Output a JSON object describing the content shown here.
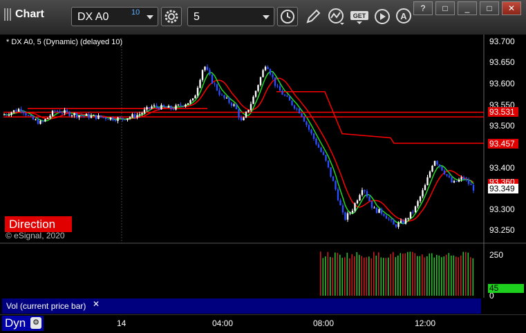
{
  "app": {
    "title": "Chart"
  },
  "toolbar": {
    "symbol": "DX A0",
    "delay": "10",
    "interval": "5",
    "icons": [
      "settings-gear-icon",
      "clock-icon",
      "pencil-icon",
      "indicator-icon",
      "get-icon",
      "play-icon",
      "alert-icon"
    ]
  },
  "window_buttons": {
    "help": "?",
    "restore_small": "□",
    "minimize": "_",
    "maximize": "□",
    "close": "✕"
  },
  "chart": {
    "label": "* DX A0, 5 (Dynamic) (delayed 10)",
    "direction": "Direction",
    "copyright": "© eSignal, 2020",
    "price_ticks": [
      "93.700",
      "93.650",
      "93.600",
      "93.550",
      "93.500",
      "93.400",
      "93.300",
      "93.250"
    ],
    "price_tags": [
      {
        "text": "93.531",
        "color": "#e00000",
        "fg": "#ffffff"
      },
      {
        "text": "93.457",
        "color": "#e00000",
        "fg": "#ffffff"
      },
      {
        "text": "93.360",
        "color": "#e00000",
        "fg": "#ffffff"
      },
      {
        "text": "93.349",
        "color": "#ffffff",
        "fg": "#000000"
      }
    ],
    "vol_ticks": [
      "250",
      "0"
    ],
    "vol_tag": "45",
    "vol_label": "Vol (current price bar)",
    "vol_close": "✕",
    "time_ticks": [
      "14",
      "04:00",
      "08:00",
      "12:00"
    ],
    "dyn": "Dyn",
    "colors": {
      "up": "#ffffff",
      "down": "#2a4dff",
      "ma_red": "#ff0000",
      "ma_green": "#22dd22",
      "vol_green": "#2bbf2b",
      "vol_red": "#c81e1e"
    }
  }
}
